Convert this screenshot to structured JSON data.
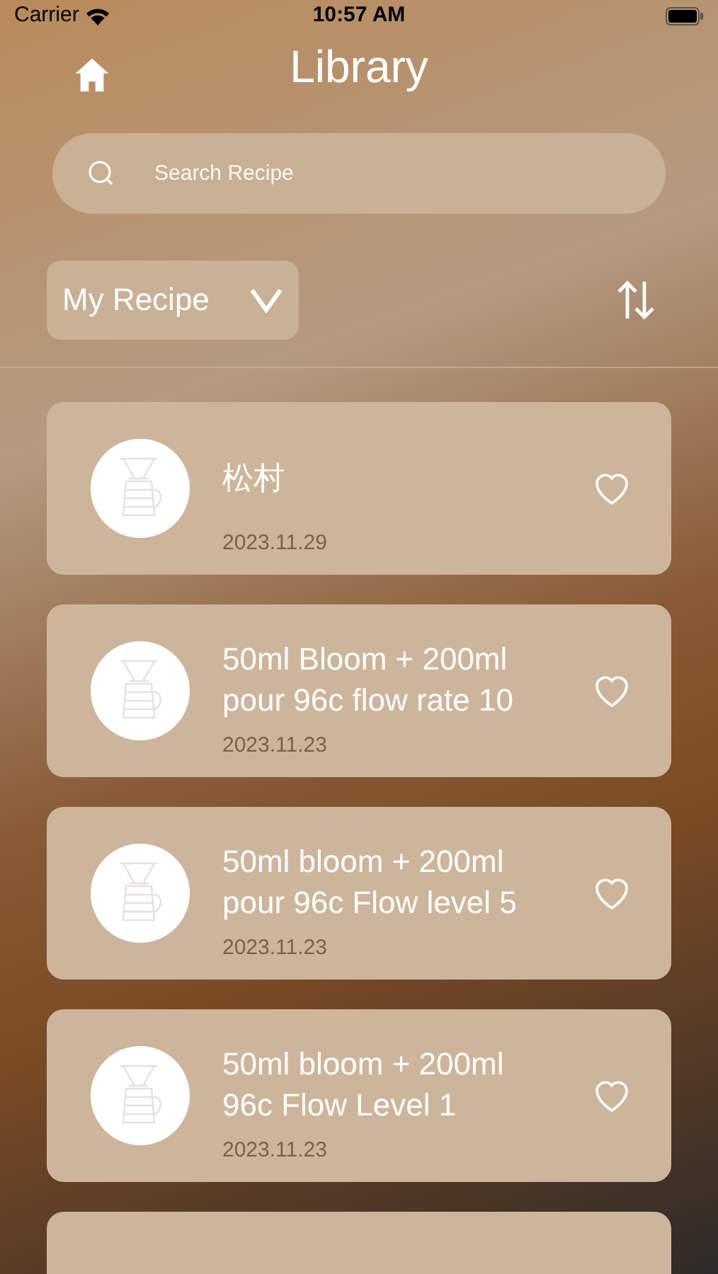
{
  "status_bar": {
    "carrier": "Carrier",
    "time": "10:57 AM"
  },
  "header": {
    "title": "Library"
  },
  "search": {
    "placeholder": "Search Recipe"
  },
  "filter": {
    "label": "My Recipe"
  },
  "recipes": [
    {
      "title": "松村",
      "date": "2023.11.29",
      "favorite": false
    },
    {
      "title": "50ml Bloom + 200ml pour 96c flow rate 10",
      "date": "2023.11.23",
      "favorite": false
    },
    {
      "title": "50ml bloom + 200ml pour 96c Flow level 5",
      "date": "2023.11.23",
      "favorite": false
    },
    {
      "title": "50ml bloom + 200ml 96c Flow Level 1",
      "date": "2023.11.23",
      "favorite": false
    }
  ]
}
